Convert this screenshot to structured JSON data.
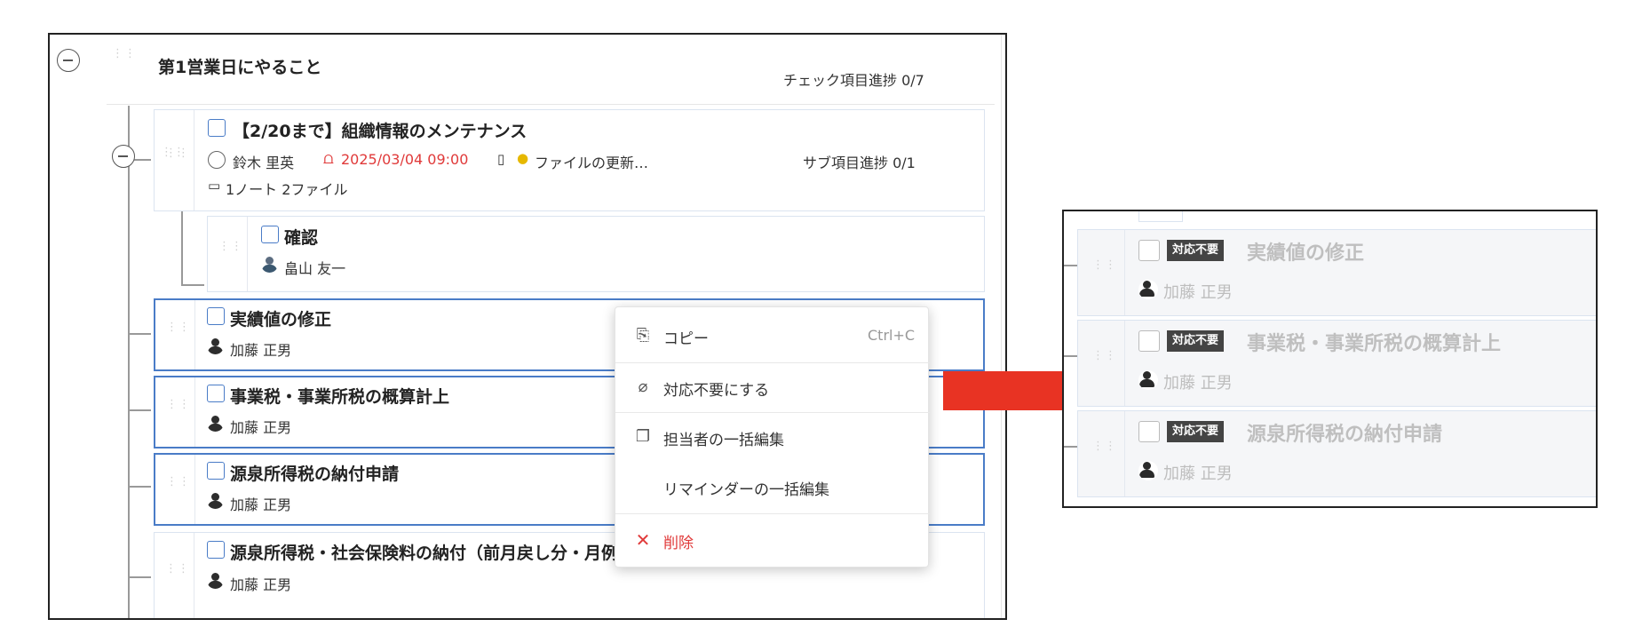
{
  "section": {
    "title": "第1営業日にやること",
    "progress": "チェック項目進捗 0/7"
  },
  "items": [
    {
      "title": "【2/20まで】組織情報のメンテナンス",
      "assignee": "鈴木 里英",
      "reminder": "2025/03/04 09:00",
      "note_preview": "ファイルの更新…",
      "attachments": "1ノート  2ファイル",
      "progress": "サブ項目進捗 0/1"
    },
    {
      "title": "確認",
      "assignee": "畠山 友一"
    },
    {
      "title": "実績値の修正",
      "assignee": "加藤 正男"
    },
    {
      "title": "事業税・事業所税の概算計上",
      "assignee": "加藤 正男"
    },
    {
      "title": "源泉所得税の納付申請",
      "assignee": "加藤 正男"
    },
    {
      "title": "源泉所得税・社会保険料の納付（前月戻し分・月例源泉）",
      "assignee": "加藤 正男"
    }
  ],
  "context_menu": {
    "copy": "コピー",
    "copy_shortcut": "Ctrl+C",
    "mark_not_required": "対応不要にする",
    "bulk_edit_assignee": "担当者の一括編集",
    "bulk_edit_reminder": "リマインダーの一括編集",
    "delete": "削除"
  },
  "result_panel": {
    "badge": "対応不要",
    "items": [
      {
        "title": "実績値の修正",
        "assignee": "加藤 正男"
      },
      {
        "title": "事業税・事業所税の概算計上",
        "assignee": "加藤 正男"
      },
      {
        "title": "源泉所得税の納付申請",
        "assignee": "加藤 正男"
      }
    ]
  },
  "icons": {
    "collapse": "minus-circle-icon",
    "drag": "drag-handle-icon",
    "reminder": "bell-icon",
    "note": "note-icon",
    "tip": "lightbulb-icon",
    "attachment": "paperclip-icon",
    "copy": "copy-icon",
    "not_required": "eraser-icon",
    "bulk_edit": "duplicate-icon",
    "delete": "close-icon",
    "arrow": "right-arrow-icon"
  },
  "colors": {
    "selected_border": "#4a7cc7",
    "reminder_red": "#e03a3a",
    "arrow_red": "#e83323",
    "delete_red": "#e03a3a",
    "badge_bg": "#444444"
  }
}
